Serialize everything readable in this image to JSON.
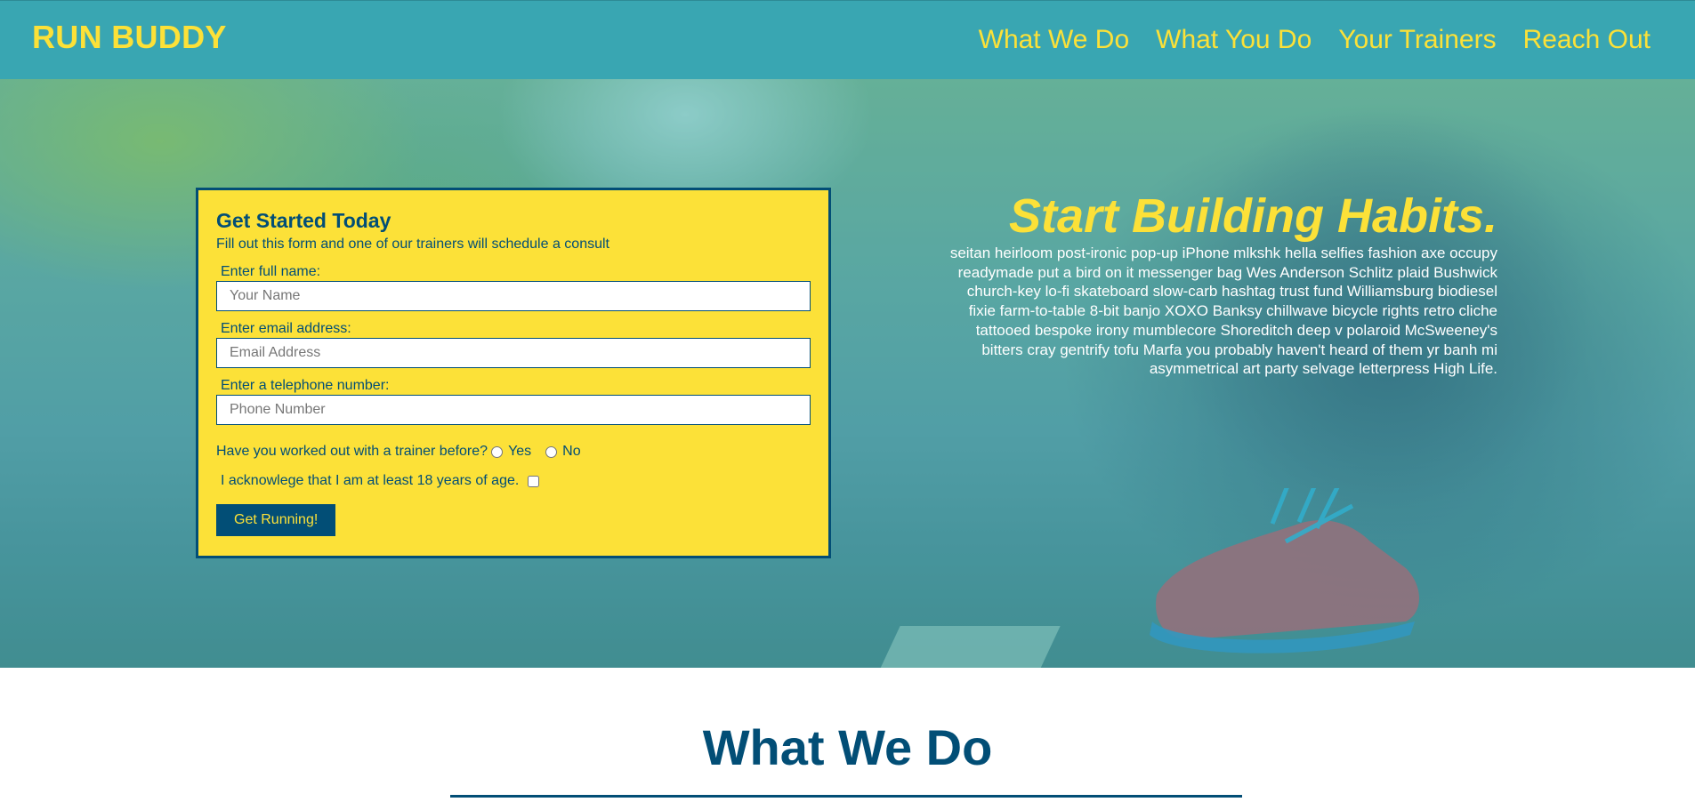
{
  "header": {
    "logo": "RUN BUDDY",
    "nav": [
      {
        "label": "What We Do"
      },
      {
        "label": "What You Do"
      },
      {
        "label": "Your Trainers"
      },
      {
        "label": "Reach Out"
      }
    ]
  },
  "form": {
    "title": "Get Started Today",
    "subtitle": "Fill out this form and one of our trainers will schedule a consult",
    "name_label": "Enter full name:",
    "name_placeholder": "Your Name",
    "email_label": "Enter email address:",
    "email_placeholder": "Email Address",
    "phone_label": "Enter a telephone number:",
    "phone_placeholder": "Phone Number",
    "trainer_question": "Have you worked out with a trainer before?",
    "option_yes": "Yes",
    "option_no": "No",
    "age_acknowledge": "I acknowlege that I am at least 18 years of age.",
    "submit_label": "Get Running!"
  },
  "hero": {
    "title": "Start Building Habits.",
    "body": "seitan heirloom post-ironic pop-up iPhone mlkshk hella selfies fashion axe occupy readymade put a bird on it messenger bag Wes Anderson Schlitz plaid Bushwick church-key lo-fi skateboard slow-carb hashtag trust fund Williamsburg biodiesel fixie farm-to-table 8-bit banjo XOXO Banksy chillwave bicycle rights retro cliche tattooed bespoke irony mumblecore Shoreditch deep v polaroid McSweeney's bitters cray gentrify tofu Marfa you probably haven't heard of them yr banh mi asymmetrical art party selvage letterpress High Life."
  },
  "section": {
    "title": "What We Do"
  },
  "colors": {
    "primary": "#39a6b2",
    "accent": "#fce138",
    "dark": "#024e76"
  }
}
